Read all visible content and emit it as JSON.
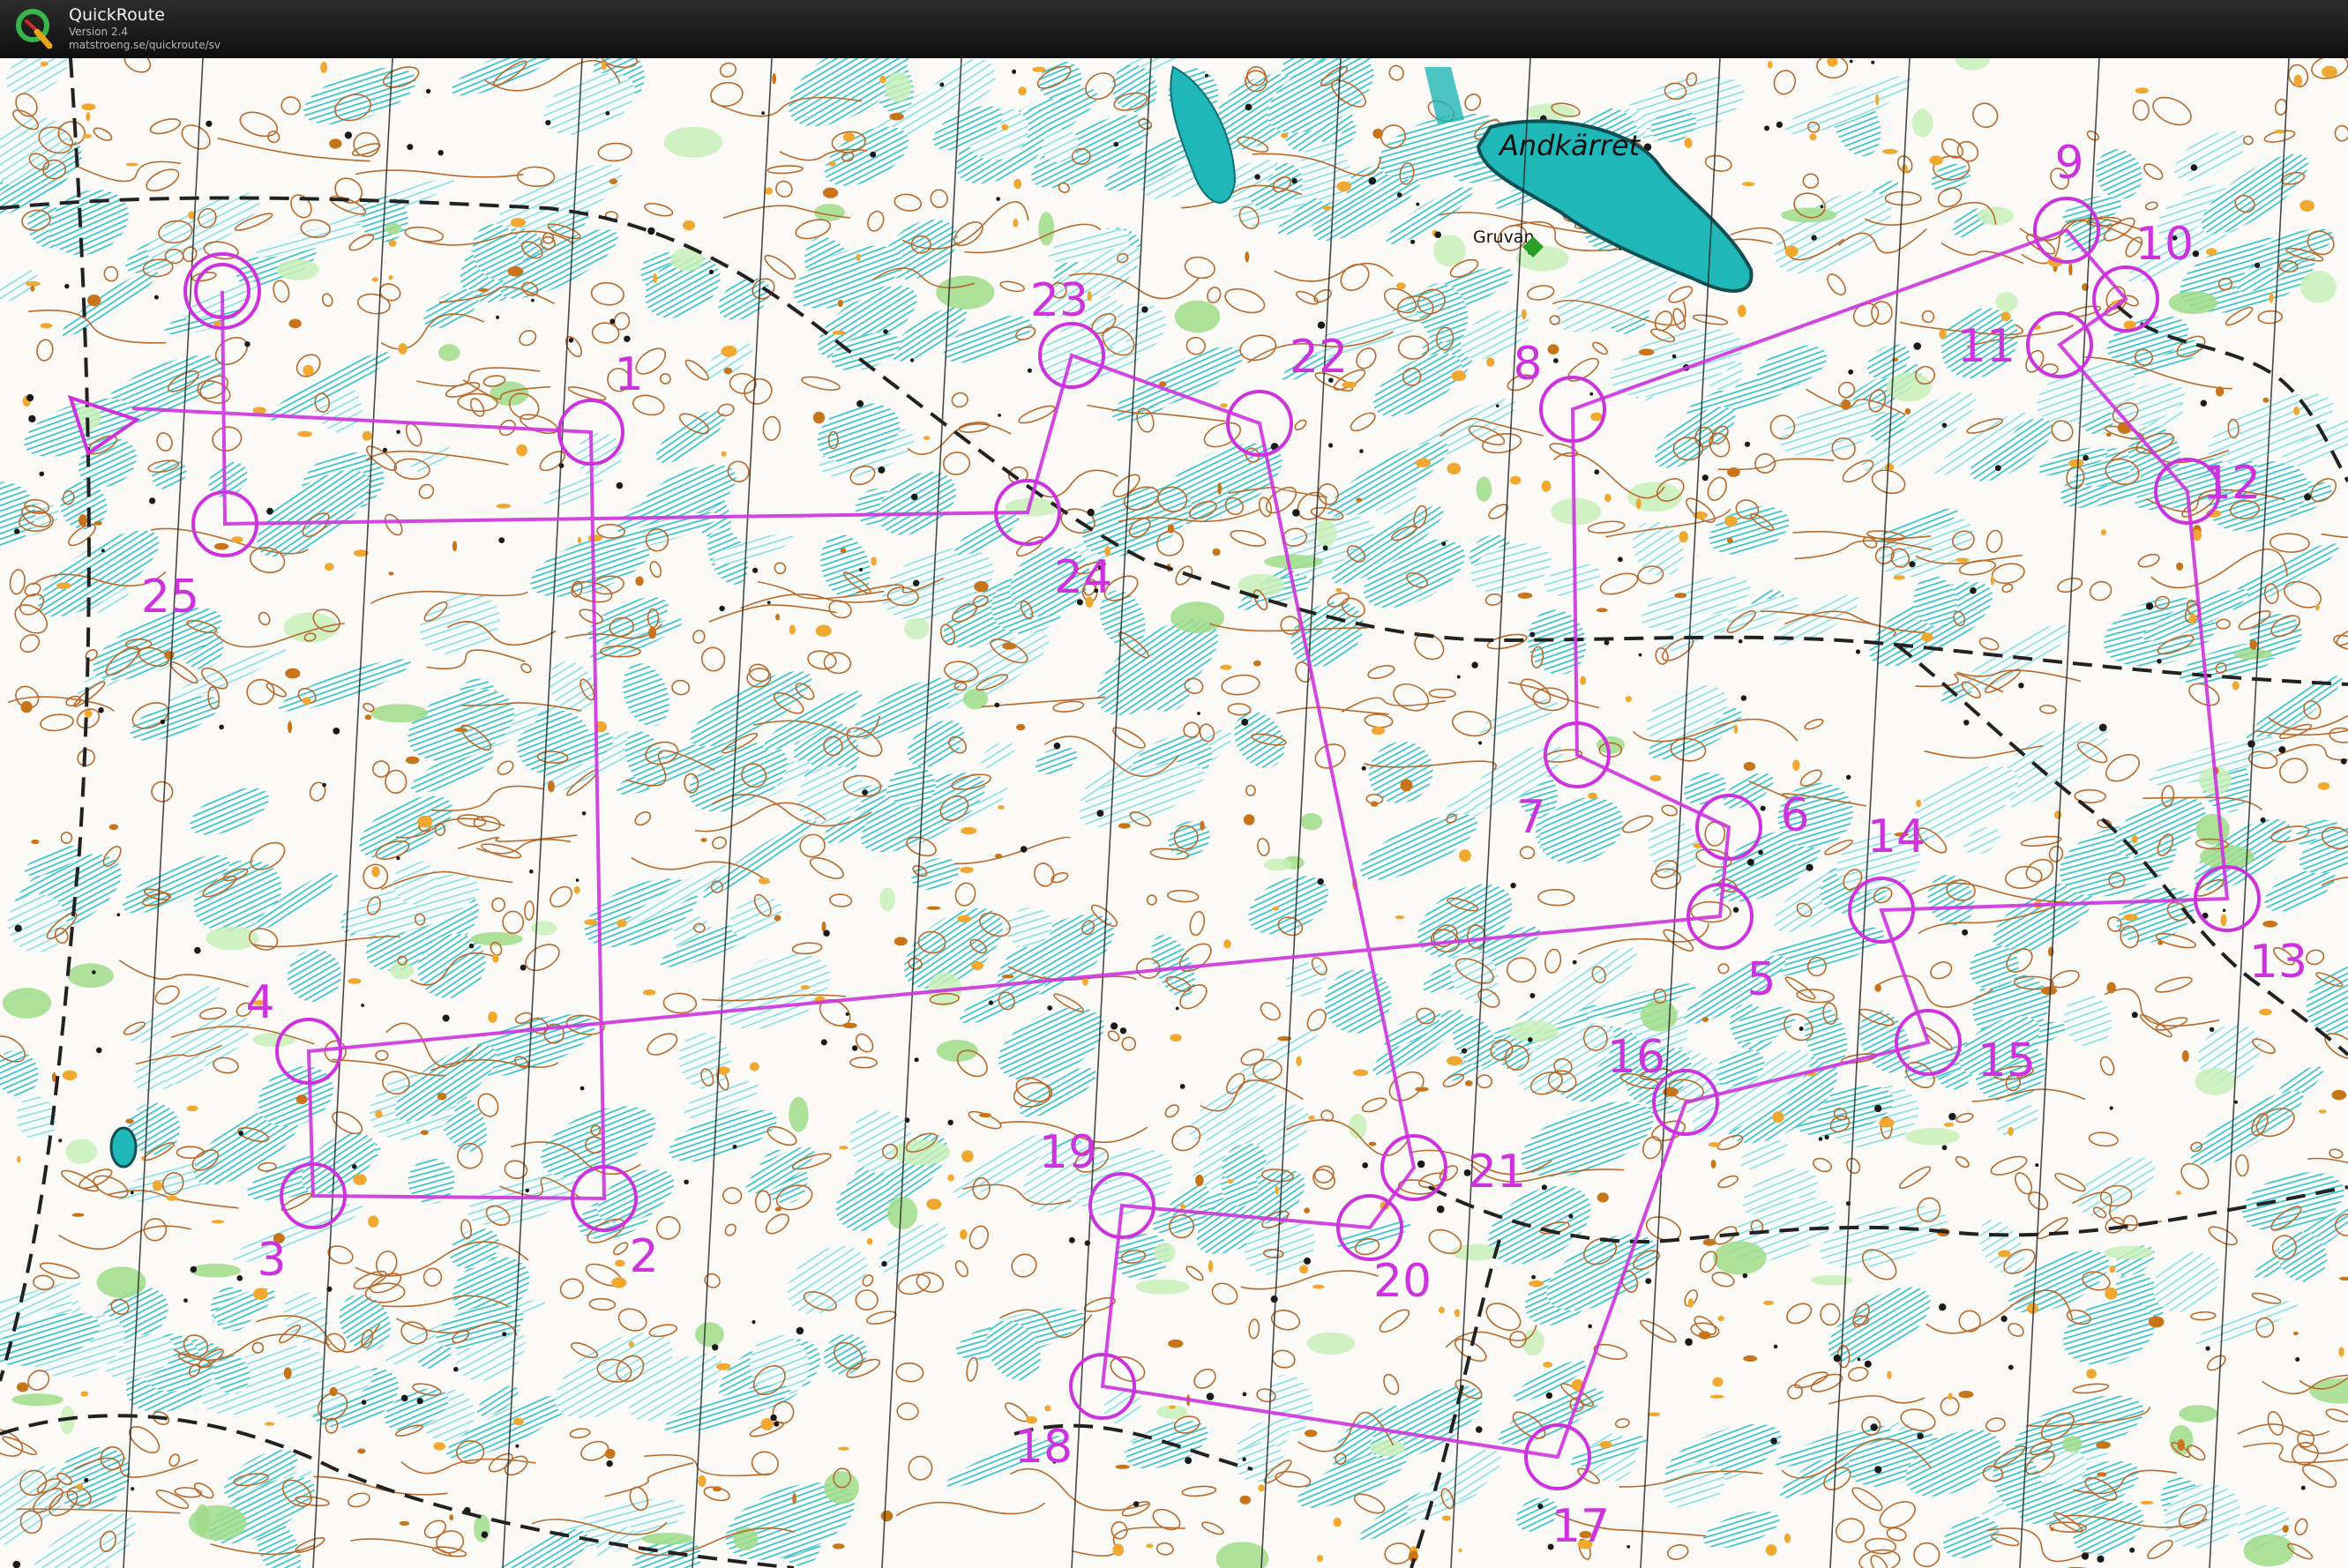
{
  "app": {
    "title": "QuickRoute",
    "version": "Version 2.4",
    "url": "matstroeng.se/quickroute/sv",
    "logo_icon": "quickroute-q-icon"
  },
  "map": {
    "place_names": {
      "lake": "Andkärret",
      "mine": "Gruvan"
    },
    "colors": {
      "course": "#cc33dd",
      "contour": "#b86a2c",
      "marsh": "#3cc3c8",
      "vegetation": "#8ed67a",
      "rock": "#f0a830",
      "water": "#1fb7b7",
      "path": "#222222"
    },
    "course": {
      "start_symbol": "start-triangle",
      "finish_symbol": "finish-double-circle",
      "controls": [
        {
          "label": "1"
        },
        {
          "label": "2"
        },
        {
          "label": "3"
        },
        {
          "label": "4"
        },
        {
          "label": "5"
        },
        {
          "label": "6"
        },
        {
          "label": "7"
        },
        {
          "label": "8"
        },
        {
          "label": "9"
        },
        {
          "label": "10"
        },
        {
          "label": "11"
        },
        {
          "label": "12"
        },
        {
          "label": "13"
        },
        {
          "label": "14"
        },
        {
          "label": "15"
        },
        {
          "label": "16"
        },
        {
          "label": "17"
        },
        {
          "label": "18"
        },
        {
          "label": "19"
        },
        {
          "label": "20"
        },
        {
          "label": "21"
        },
        {
          "label": "22"
        },
        {
          "label": "23"
        },
        {
          "label": "24"
        },
        {
          "label": "25"
        }
      ]
    }
  }
}
